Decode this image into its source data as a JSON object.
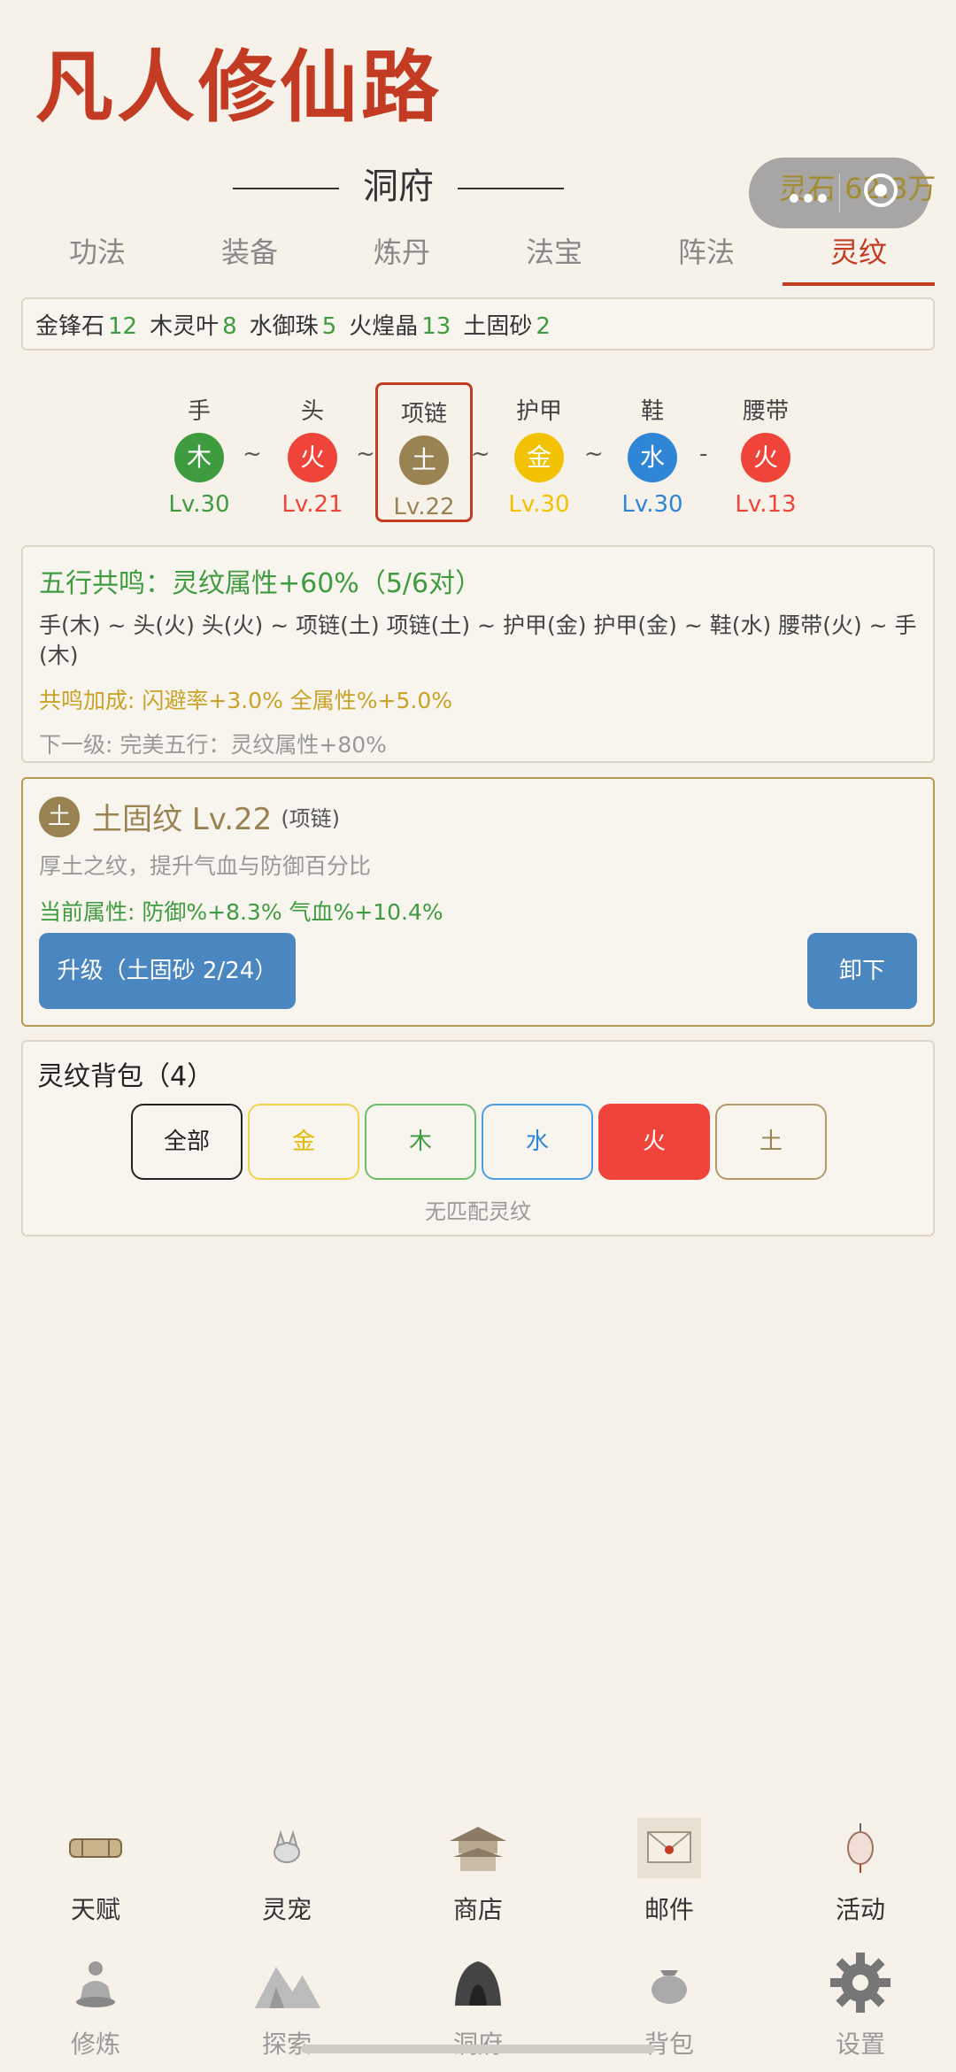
{
  "app_title": "凡人修仙路",
  "header": {
    "title": "洞府"
  },
  "capsule": {
    "stone_text": "灵石 62.3万"
  },
  "tabs": [
    {
      "label": "功法"
    },
    {
      "label": "装备"
    },
    {
      "label": "炼丹"
    },
    {
      "label": "法宝"
    },
    {
      "label": "阵法"
    },
    {
      "label": "灵纹",
      "active": true
    }
  ],
  "materials": [
    {
      "name": "金锋石",
      "count": "12"
    },
    {
      "name": "木灵叶",
      "count": "8"
    },
    {
      "name": "水御珠",
      "count": "5"
    },
    {
      "name": "火煌晶",
      "count": "13"
    },
    {
      "name": "土固砂",
      "count": "2"
    }
  ],
  "slots": [
    {
      "label": "手",
      "element": "木",
      "level": "Lv.30",
      "color": "#3f9b3f"
    },
    {
      "label": "头",
      "element": "火",
      "level": "Lv.21",
      "color": "#f0443a"
    },
    {
      "label": "项链",
      "element": "土",
      "level": "Lv.22",
      "color": "#9a8352",
      "selected": true
    },
    {
      "label": "护甲",
      "element": "金",
      "level": "Lv.30",
      "color": "#f2c200"
    },
    {
      "label": "鞋",
      "element": "水",
      "level": "Lv.30",
      "color": "#2f86d6"
    },
    {
      "label": "腰带",
      "element": "火",
      "level": "Lv.13",
      "color": "#f0443a"
    }
  ],
  "connectors": [
    "~",
    "~",
    "~",
    "~",
    "-"
  ],
  "resonance": {
    "title": "五行共鸣：灵纹属性+60%（5/6对）",
    "pairs": "手(木) ~ 头(火)  头(火) ~ 项链(土)  项链(土) ~ 护甲(金)  护甲(金) ~ 鞋(水)  腰带(火) ~ 手(木)",
    "bonus": "共鸣加成: 闪避率+3.0%  全属性%+5.0%",
    "next": "下一级: 完美五行：灵纹属性+80%"
  },
  "detail": {
    "element": "土",
    "name": "土固纹 Lv.22",
    "slot": "(项链)",
    "desc": "厚土之纹，提升气血与防御百分比",
    "attr": "当前属性: 防御%+8.3%  气血%+10.4%",
    "upgrade_label": "升级（土固砂 2/24）",
    "remove_label": "卸下"
  },
  "bag": {
    "title": "灵纹背包（4）",
    "filters": [
      "全部",
      "金",
      "木",
      "水",
      "火",
      "土"
    ],
    "active_filter": "火",
    "empty_text": "无匹配灵纹"
  },
  "nav": {
    "row1": [
      {
        "label": "天赋",
        "icon": "scroll-icon"
      },
      {
        "label": "灵宠",
        "icon": "fox-icon"
      },
      {
        "label": "商店",
        "icon": "pavilion-icon"
      },
      {
        "label": "邮件",
        "icon": "envelope-icon"
      },
      {
        "label": "活动",
        "icon": "lantern-icon"
      }
    ],
    "row2": [
      {
        "label": "修炼",
        "icon": "meditation-icon"
      },
      {
        "label": "探索",
        "icon": "mountain-icon"
      },
      {
        "label": "洞府",
        "icon": "cave-icon"
      },
      {
        "label": "背包",
        "icon": "bag-icon"
      },
      {
        "label": "设置",
        "icon": "gear-icon"
      }
    ]
  }
}
